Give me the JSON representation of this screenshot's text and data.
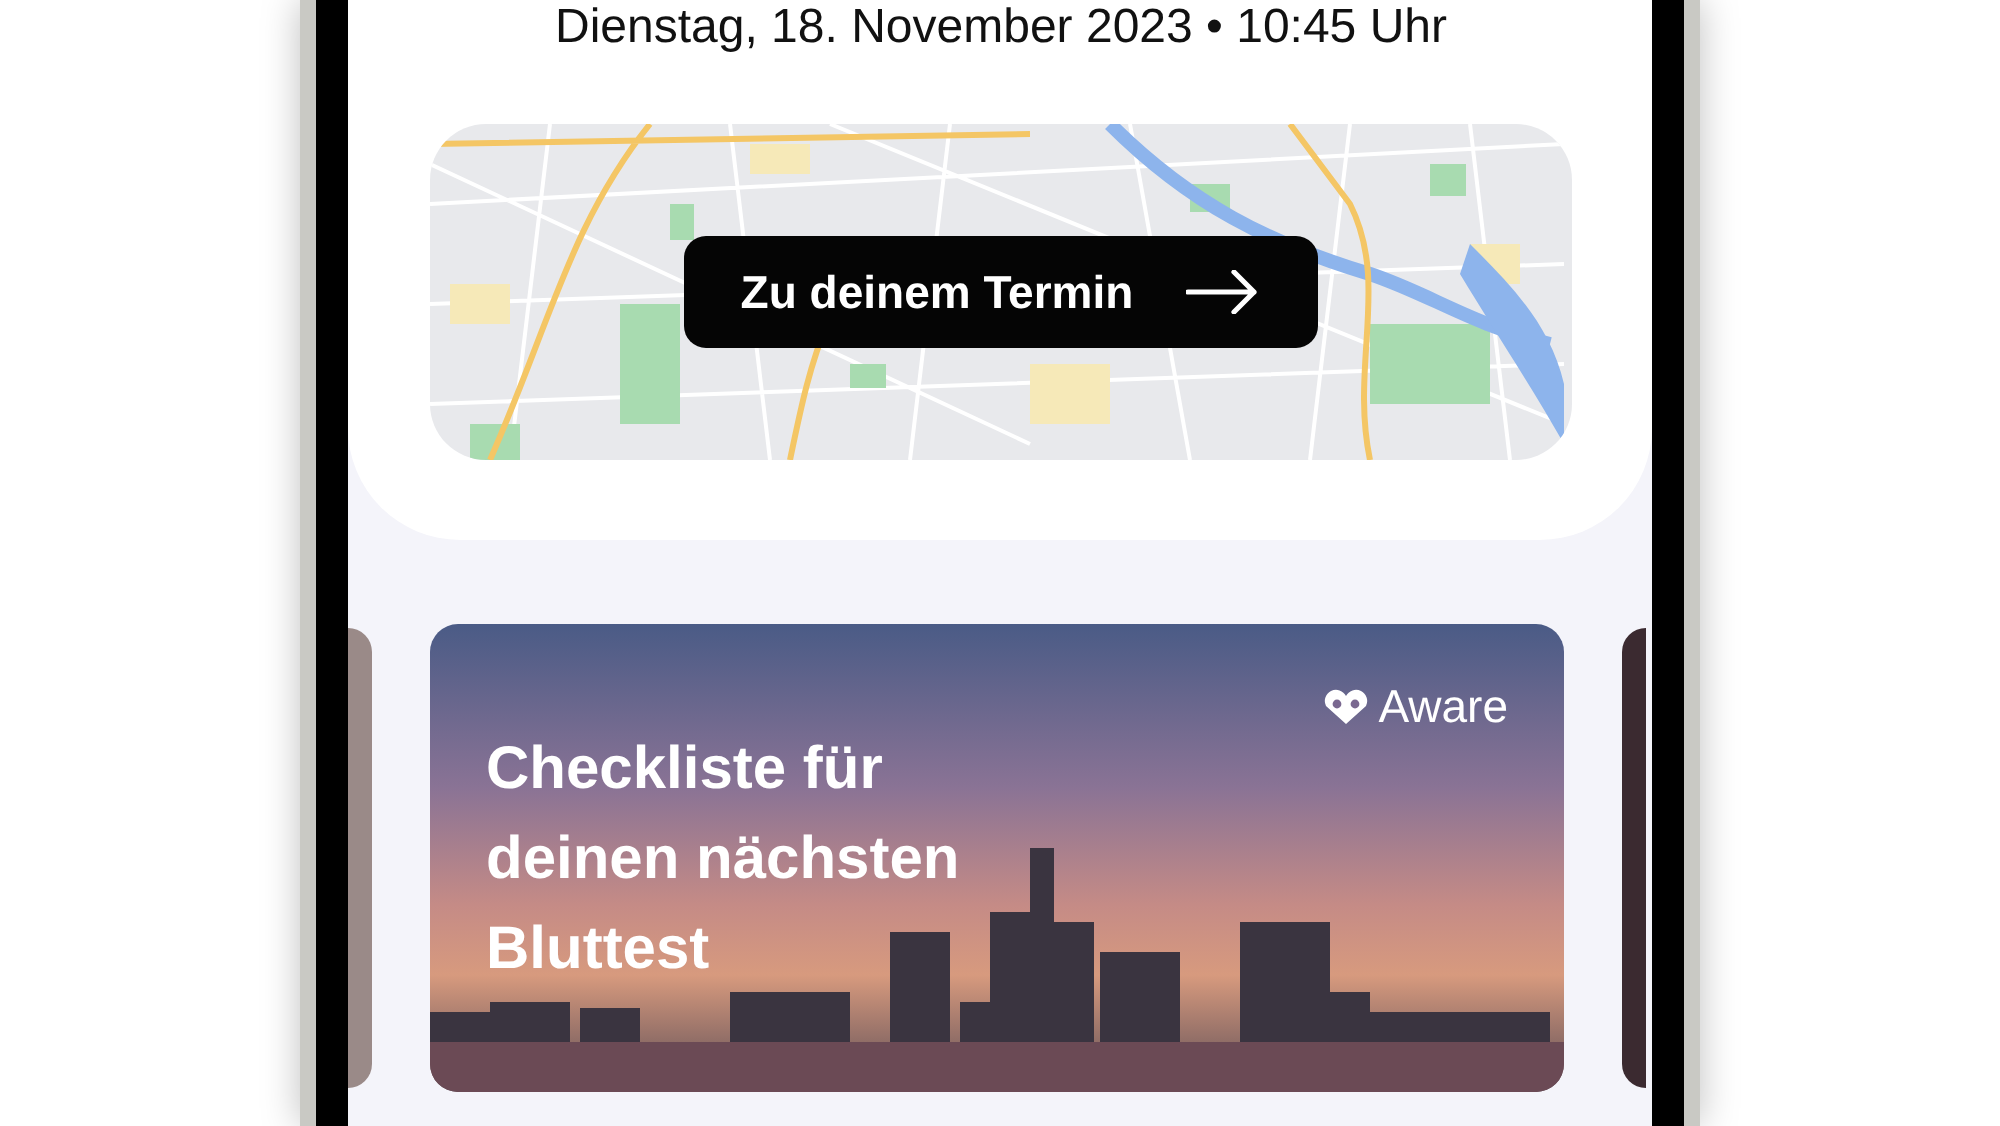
{
  "appointment": {
    "date_time": "Dienstag, 18. November 2023 • 10:45 Uhr",
    "map_button": {
      "label": "Zu deinem Termin"
    }
  },
  "carousel": {
    "cards": [
      {
        "title": "Checkliste für deinen nächsten Bluttest",
        "brand": "Aware",
        "selected": true
      }
    ]
  }
}
